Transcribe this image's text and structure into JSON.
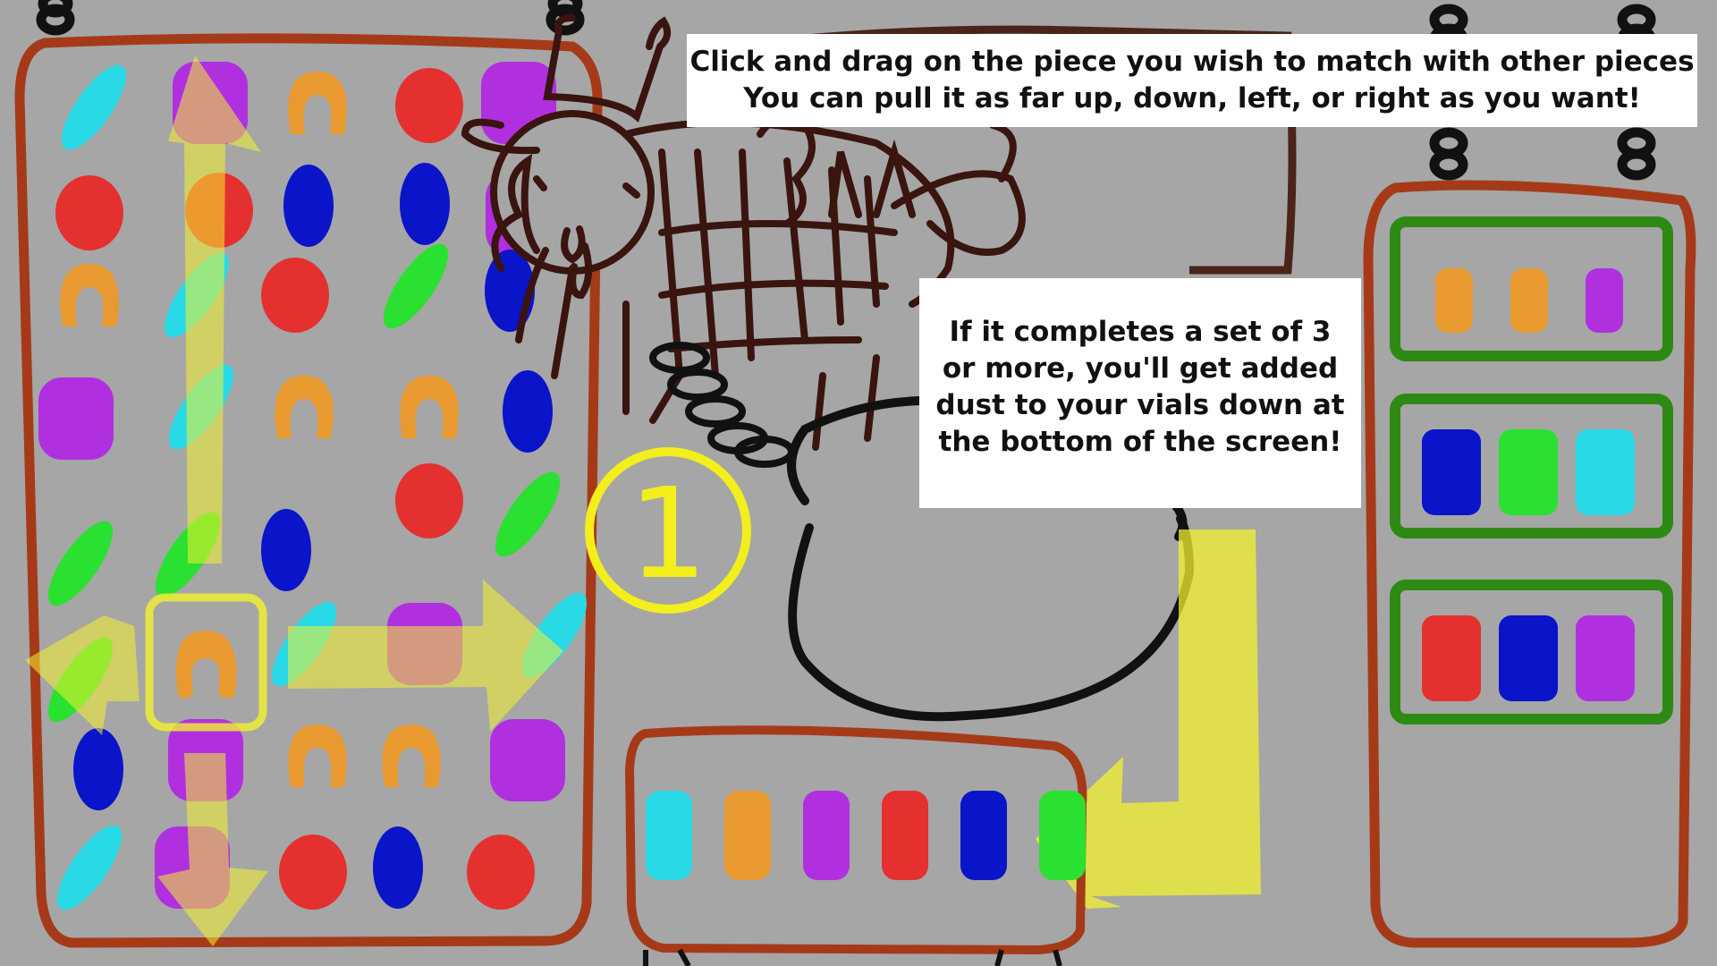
{
  "tutorial": {
    "instruction_top": {
      "line1": "Click and drag on the piece you wish to match with other pieces",
      "line2": "You can pull it as far up, down, left, or right as you want!"
    },
    "instruction_right": {
      "line1": "If it completes a set of 3",
      "line2": "or more, you'll get added",
      "line3": "dust to your vials down at",
      "line4": "the bottom of the screen!"
    },
    "step_number": "1"
  },
  "board": {
    "columns": 5,
    "rows": 9,
    "selected_piece": {
      "row": 7,
      "column": 2,
      "kind": "orange-horseshoe"
    }
  },
  "piece_colors": {
    "cyan": "#2ad9e6",
    "orange": "#e89a30",
    "purple": "#b030e0",
    "red": "#e53030",
    "blue": "#0a14c8",
    "green": "#2ae030"
  },
  "vial_tray": {
    "vials": [
      "cyan",
      "orange",
      "purple",
      "red",
      "blue",
      "green"
    ]
  },
  "shelf": {
    "rows": [
      [
        "orange",
        "orange",
        "purple"
      ],
      [
        "blue",
        "green",
        "cyan"
      ],
      [
        "red",
        "blue",
        "purple"
      ]
    ]
  },
  "arrow_color": "#f2f230",
  "frame_color": "#a63a18",
  "shelf_box_color": "#2e8a14"
}
